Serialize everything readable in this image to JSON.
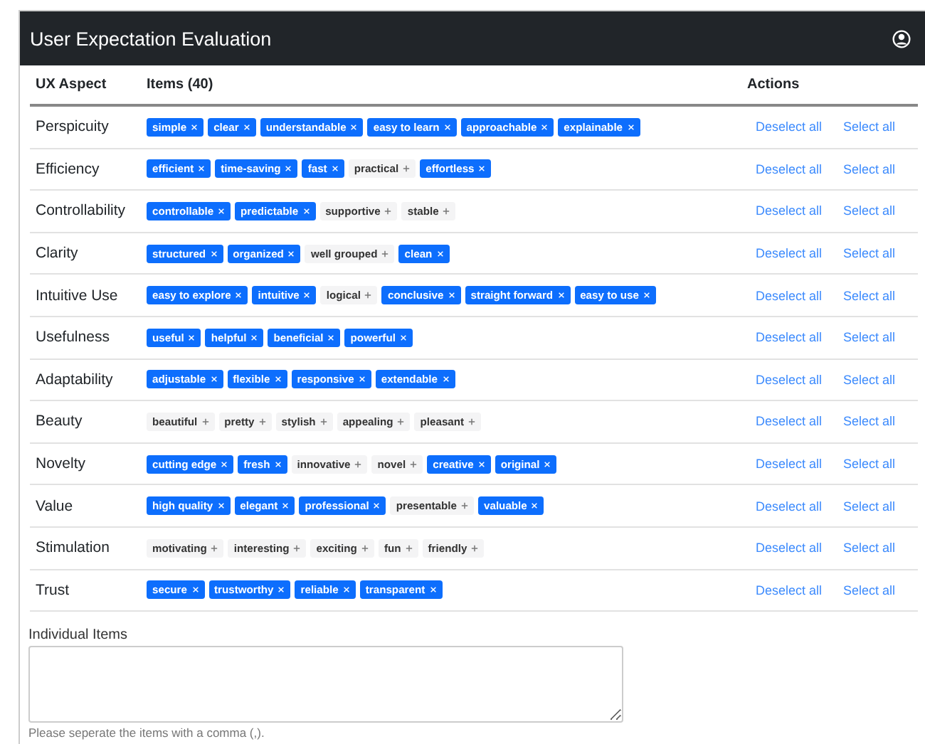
{
  "header": {
    "title": "User Expectation Evaluation"
  },
  "table": {
    "columns": [
      "UX Aspect",
      "Items (40)",
      "Actions"
    ],
    "rows": [
      {
        "aspect": "Perspicuity",
        "items": [
          {
            "label": "simple",
            "selected": true
          },
          {
            "label": "clear",
            "selected": true
          },
          {
            "label": "understandable",
            "selected": true
          },
          {
            "label": "easy to learn",
            "selected": true
          },
          {
            "label": "approachable",
            "selected": true
          },
          {
            "label": "explainable",
            "selected": true
          }
        ],
        "actions": [
          "Deselect all",
          "Select all"
        ]
      },
      {
        "aspect": "Efficiency",
        "items": [
          {
            "label": "efficient",
            "selected": true
          },
          {
            "label": "time-saving",
            "selected": true
          },
          {
            "label": "fast",
            "selected": true
          },
          {
            "label": "practical",
            "selected": false
          },
          {
            "label": "effortless",
            "selected": true
          }
        ],
        "actions": [
          "Deselect all",
          "Select all"
        ]
      },
      {
        "aspect": "Controllability",
        "items": [
          {
            "label": "controllable",
            "selected": true
          },
          {
            "label": "predictable",
            "selected": true
          },
          {
            "label": "supportive",
            "selected": false
          },
          {
            "label": "stable",
            "selected": false
          }
        ],
        "actions": [
          "Deselect all",
          "Select all"
        ]
      },
      {
        "aspect": "Clarity",
        "items": [
          {
            "label": "structured",
            "selected": true
          },
          {
            "label": "organized",
            "selected": true
          },
          {
            "label": "well grouped",
            "selected": false
          },
          {
            "label": "clean",
            "selected": true
          }
        ],
        "actions": [
          "Deselect all",
          "Select all"
        ]
      },
      {
        "aspect": "Intuitive Use",
        "items": [
          {
            "label": "easy to explore",
            "selected": true
          },
          {
            "label": "intuitive",
            "selected": true
          },
          {
            "label": "logical",
            "selected": false
          },
          {
            "label": "conclusive",
            "selected": true
          },
          {
            "label": "straight forward",
            "selected": true
          },
          {
            "label": "easy to use",
            "selected": true
          }
        ],
        "actions": [
          "Deselect all",
          "Select all"
        ]
      },
      {
        "aspect": "Usefulness",
        "items": [
          {
            "label": "useful",
            "selected": true
          },
          {
            "label": "helpful",
            "selected": true
          },
          {
            "label": "beneficial",
            "selected": true
          },
          {
            "label": "powerful",
            "selected": true
          }
        ],
        "actions": [
          "Deselect all",
          "Select all"
        ]
      },
      {
        "aspect": "Adaptability",
        "items": [
          {
            "label": "adjustable",
            "selected": true
          },
          {
            "label": "flexible",
            "selected": true
          },
          {
            "label": "responsive",
            "selected": true
          },
          {
            "label": "extendable",
            "selected": true
          }
        ],
        "actions": [
          "Deselect all",
          "Select all"
        ]
      },
      {
        "aspect": "Beauty",
        "items": [
          {
            "label": "beautiful",
            "selected": false
          },
          {
            "label": "pretty",
            "selected": false
          },
          {
            "label": "stylish",
            "selected": false
          },
          {
            "label": "appealing",
            "selected": false
          },
          {
            "label": "pleasant",
            "selected": false
          }
        ],
        "actions": [
          "Deselect all",
          "Select all"
        ]
      },
      {
        "aspect": "Novelty",
        "items": [
          {
            "label": "cutting edge",
            "selected": true
          },
          {
            "label": "fresh",
            "selected": true
          },
          {
            "label": "innovative",
            "selected": false
          },
          {
            "label": "novel",
            "selected": false
          },
          {
            "label": "creative",
            "selected": true
          },
          {
            "label": "original",
            "selected": true
          }
        ],
        "actions": [
          "Deselect all",
          "Select all"
        ]
      },
      {
        "aspect": "Value",
        "items": [
          {
            "label": "high quality",
            "selected": true
          },
          {
            "label": "elegant",
            "selected": true
          },
          {
            "label": "professional",
            "selected": true
          },
          {
            "label": "presentable",
            "selected": false
          },
          {
            "label": "valuable",
            "selected": true
          }
        ],
        "actions": [
          "Deselect all",
          "Select all"
        ]
      },
      {
        "aspect": "Stimulation",
        "items": [
          {
            "label": "motivating",
            "selected": false
          },
          {
            "label": "interesting",
            "selected": false
          },
          {
            "label": "exciting",
            "selected": false
          },
          {
            "label": "fun",
            "selected": false
          },
          {
            "label": "friendly",
            "selected": false
          }
        ],
        "actions": [
          "Deselect all",
          "Select all"
        ]
      },
      {
        "aspect": "Trust",
        "items": [
          {
            "label": "secure",
            "selected": true
          },
          {
            "label": "trustworthy",
            "selected": true
          },
          {
            "label": "reliable",
            "selected": true
          },
          {
            "label": "transparent",
            "selected": true
          }
        ],
        "actions": [
          "Deselect all",
          "Select all"
        ]
      }
    ]
  },
  "individual_items": {
    "label": "Individual Items",
    "hint": "Please seperate the items with a comma (,)."
  }
}
